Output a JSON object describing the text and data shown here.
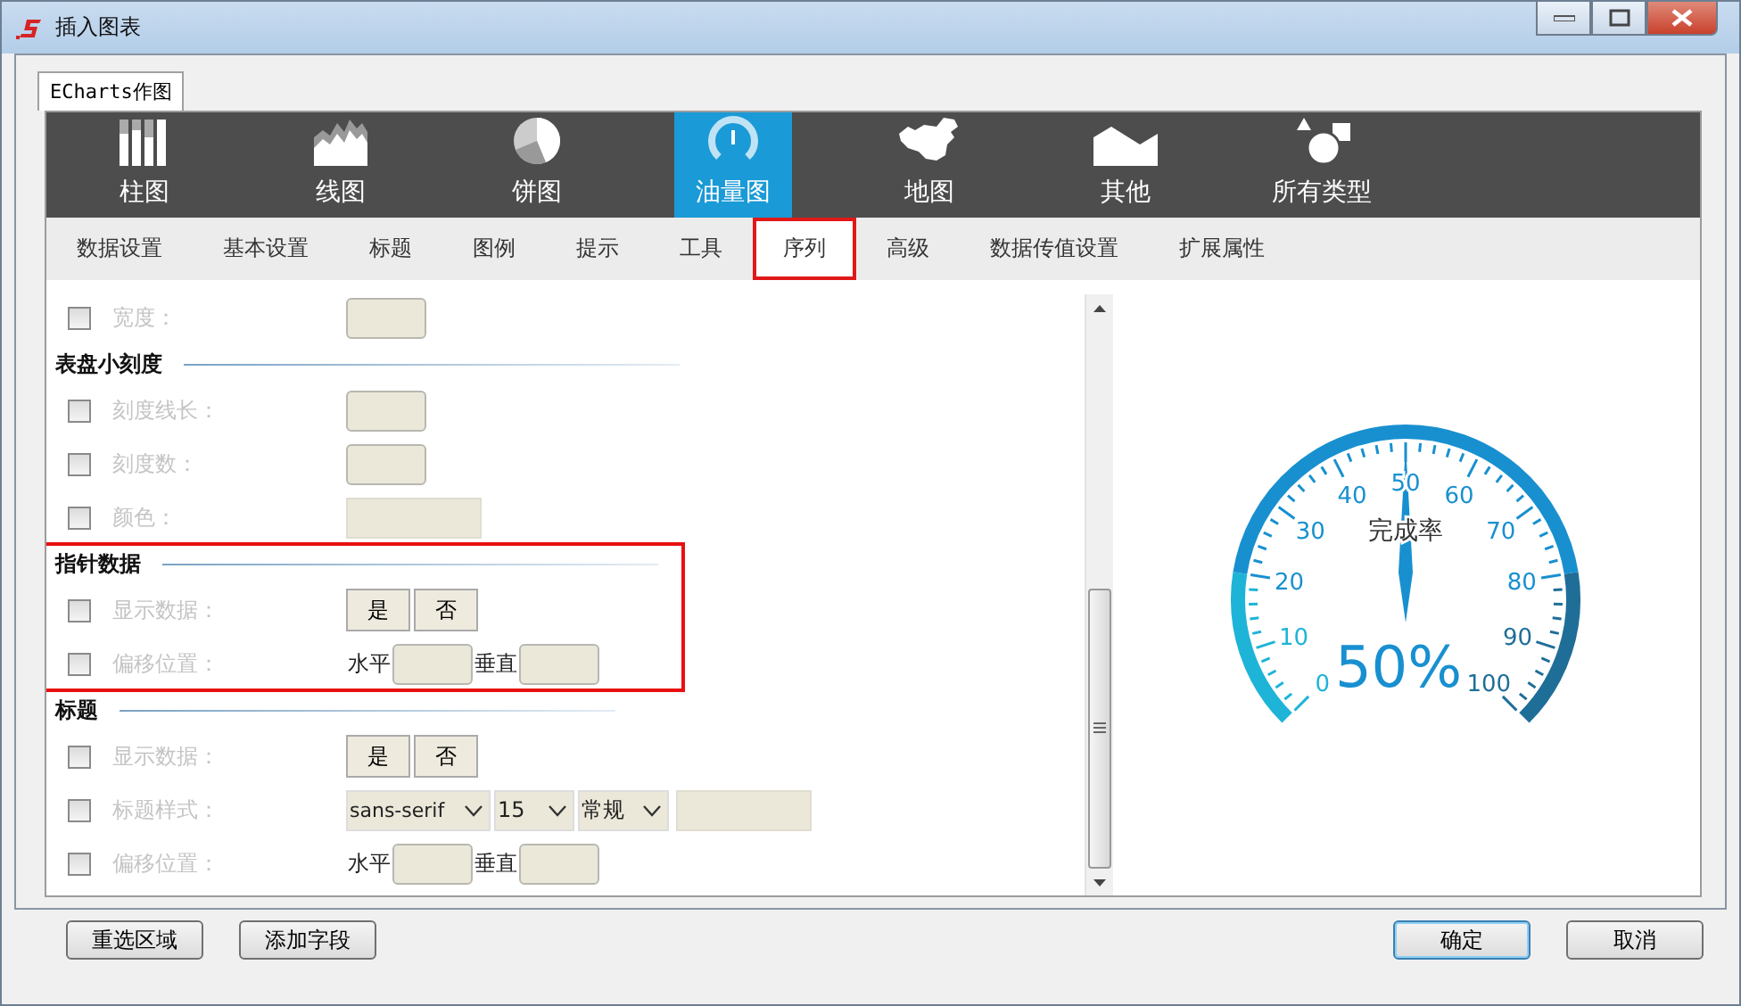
{
  "window": {
    "title": "插入图表"
  },
  "outer_tabs": [
    {
      "label": "ECharts作图",
      "selected": true
    }
  ],
  "chart_types": [
    {
      "label": "柱图",
      "kind": "bar",
      "selected": false
    },
    {
      "label": "线图",
      "kind": "area",
      "selected": false
    },
    {
      "label": "饼图",
      "kind": "pie",
      "selected": false
    },
    {
      "label": "油量图",
      "kind": "gauge",
      "selected": true
    },
    {
      "label": "地图",
      "kind": "map",
      "selected": false
    },
    {
      "label": "其他",
      "kind": "other",
      "selected": false
    },
    {
      "label": "所有类型",
      "kind": "shapes",
      "selected": false
    }
  ],
  "settings_tabs": [
    {
      "label": "数据设置",
      "selected": false
    },
    {
      "label": "基本设置",
      "selected": false
    },
    {
      "label": "标题",
      "selected": false
    },
    {
      "label": "图例",
      "selected": false
    },
    {
      "label": "提示",
      "selected": false
    },
    {
      "label": "工具",
      "selected": false
    },
    {
      "label": "序列",
      "selected": true
    },
    {
      "label": "高级",
      "selected": false
    },
    {
      "label": "数据传值设置",
      "selected": false
    },
    {
      "label": "扩展属性",
      "selected": false
    }
  ],
  "form": [
    {
      "highlighted": false,
      "rows": [
        {
          "label": "宽度：",
          "checked": false,
          "kind": "input"
        }
      ]
    },
    {
      "title": "表盘小刻度",
      "highlighted": false,
      "rows": [
        {
          "label": "刻度线长：",
          "checked": false,
          "kind": "input"
        },
        {
          "label": "刻度数：",
          "checked": false,
          "kind": "input"
        },
        {
          "label": "颜色：",
          "checked": false,
          "kind": "wide-input"
        }
      ]
    },
    {
      "title": "指针数据",
      "highlighted": true,
      "rows": [
        {
          "label": "显示数据：",
          "checked": false,
          "kind": "buttons",
          "options": [
            "是",
            "否"
          ]
        },
        {
          "label": "偏移位置：",
          "checked": false,
          "kind": "offset",
          "parts": [
            "水平",
            "垂直"
          ]
        }
      ]
    },
    {
      "title": "标题",
      "highlighted": false,
      "rows": [
        {
          "label": "显示数据：",
          "checked": false,
          "kind": "buttons",
          "options": [
            "是",
            "否"
          ]
        },
        {
          "label": "标题样式：",
          "checked": false,
          "kind": "font",
          "selects": [
            "sans-serif",
            "15",
            "常规"
          ]
        },
        {
          "label": "偏移位置：",
          "checked": false,
          "kind": "offset",
          "parts": [
            "水平",
            "垂直"
          ]
        }
      ]
    }
  ],
  "gauge": {
    "title": "完成率",
    "value_text": "50%",
    "tick_labels": [
      "0",
      "10",
      "20",
      "30",
      "40",
      "50",
      "60",
      "70",
      "80",
      "90",
      "100"
    ]
  },
  "footer": {
    "left": [
      {
        "label": "重选区域",
        "default": false
      },
      {
        "label": "添加字段",
        "default": false
      }
    ],
    "right": [
      {
        "label": "确定",
        "default": true
      },
      {
        "label": "取消",
        "default": false
      }
    ]
  }
}
